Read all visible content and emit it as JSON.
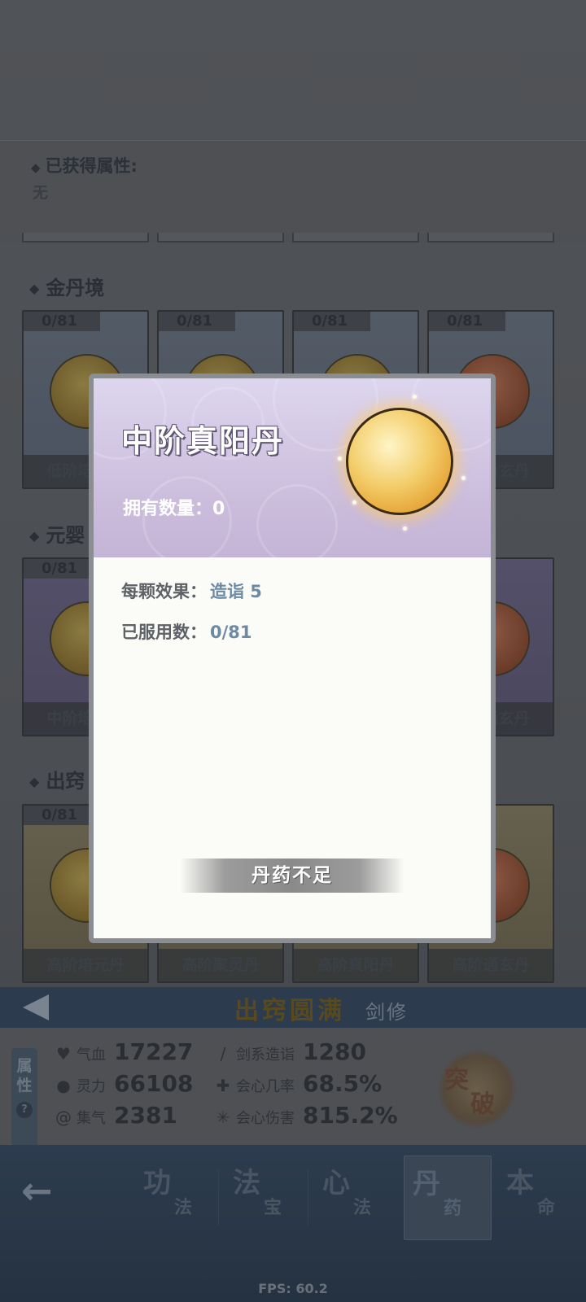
{
  "attributes_panel": {
    "title": "已获得属性:",
    "value": "无"
  },
  "sections": [
    {
      "title": "金丹境"
    },
    {
      "title": "元婴"
    },
    {
      "title": "出窍"
    }
  ],
  "cards": {
    "row1": [
      {
        "count": "0/81",
        "name": "低阶培元丹"
      },
      {
        "count": "0/81",
        "name": ""
      },
      {
        "count": "0/81",
        "name": ""
      },
      {
        "count": "0/81",
        "name": "低阶通玄丹"
      }
    ],
    "row2": [
      {
        "count": "0/81",
        "name": "中阶培元丹"
      },
      {
        "count": "",
        "name": ""
      },
      {
        "count": "",
        "name": ""
      },
      {
        "count": "",
        "name": "中阶通玄丹"
      }
    ],
    "row3": [
      {
        "count": "0/81",
        "name": "高阶培元丹"
      },
      {
        "count": "",
        "name": "高阶聚灵丹"
      },
      {
        "count": "",
        "name": "高阶真阳丹"
      },
      {
        "count": "",
        "name": "高阶通玄丹"
      }
    ]
  },
  "status": {
    "realm": "出窍圆满",
    "class": "剑修"
  },
  "attr_tab": {
    "label": "属性",
    "help": "?"
  },
  "stats": {
    "qixue": {
      "icon": "heart-icon",
      "label": "气血",
      "value": "17227"
    },
    "lingli": {
      "icon": "drop-icon",
      "label": "灵力",
      "value": "66108"
    },
    "jiqi": {
      "icon": "swirl-icon",
      "label": "集气",
      "value": "2381"
    },
    "jianxi": {
      "icon": "sword-icon",
      "label": "剑系造诣",
      "value": "1280"
    },
    "huixin_rate": {
      "icon": "crit-icon",
      "label": "会心几率",
      "value": "68.5%"
    },
    "huixin_dmg": {
      "icon": "burst-icon",
      "label": "会心伤害",
      "value": "815.2%"
    }
  },
  "breakthrough": {
    "a": "突",
    "b": "破"
  },
  "nav": {
    "back": "←",
    "items": [
      {
        "big": "功",
        "small": "法"
      },
      {
        "big": "法",
        "small": "宝"
      },
      {
        "big": "心",
        "small": "法"
      },
      {
        "big": "丹",
        "small": "药"
      },
      {
        "big": "本",
        "small": "命"
      }
    ]
  },
  "fps": "FPS: 60.2",
  "modal": {
    "title": "中阶真阳丹",
    "owned": "拥有数量：0",
    "effect_label": "每颗效果：",
    "effect_value": "造诣 5",
    "used_label": "已服用数：",
    "used_value": "0/81",
    "button": "丹药不足"
  },
  "colors": {
    "modal_header": "#cbbcdc",
    "value_blue": "#6e8aa3",
    "pill_gold": "#f3cd6a",
    "disabled_button": "#8a8a8a"
  }
}
